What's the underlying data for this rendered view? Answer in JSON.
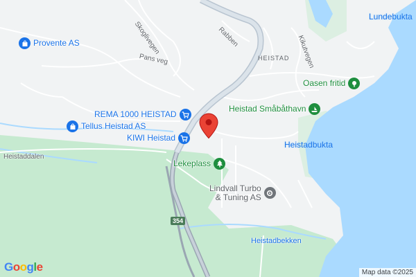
{
  "map": {
    "colors": {
      "land": "#f1f3f4",
      "water": "#aadaff",
      "green": "#c6ead0",
      "road": "#ffffff",
      "highway": "#9aa6b2",
      "marker": "#ea4335"
    },
    "area_label": "HEISTAD",
    "streets": {
      "skoglivegen": "Skoglivegen",
      "rabben": "Rabben",
      "kikutvegen": "Kikutvegen",
      "pans_veg": "Pans veg",
      "heistaddalen": "Heistaddalen"
    },
    "route_shield": "354",
    "pois": {
      "provente": {
        "label": "Provente AS",
        "icon": "shopping-bag-icon"
      },
      "rema": {
        "label": "REMA 1000 HEISTAD",
        "icon": "shopping-cart-icon"
      },
      "tellus": {
        "label": "Tellus Heistad AS",
        "icon": "shopping-bag-icon"
      },
      "kiwi": {
        "label": "KIWI Heistad",
        "icon": "shopping-cart-icon"
      },
      "lekeplass": {
        "label": "Lekeplass",
        "icon": "tree-icon"
      },
      "lindvall": {
        "label": "Lindvall Turbo\n& Tuning AS",
        "label_line1": "Lindvall Turbo",
        "label_line2": "& Tuning AS",
        "icon": "gear-icon"
      },
      "oasen": {
        "label": "Oasen fritid",
        "icon": "park-icon"
      },
      "smabathavn": {
        "label": "Heistad Småbåthavn",
        "icon": "marina-icon"
      }
    },
    "water_labels": {
      "lundebukta": "Lundebukta",
      "heistadbukta": "Heistadbukta"
    },
    "creek_label": "Heistadbekken",
    "attribution": "Map data ©2025",
    "logo": "Google"
  }
}
